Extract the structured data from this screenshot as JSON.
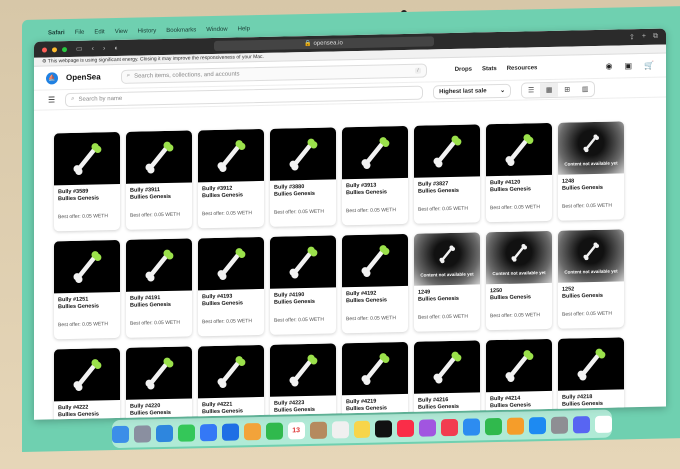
{
  "menubar": {
    "apple": "",
    "app": "Safari",
    "items": [
      "File",
      "Edit",
      "View",
      "History",
      "Bookmarks",
      "Window",
      "Help"
    ]
  },
  "browser": {
    "url": "opensea.io",
    "energy_notice": "This webpage is using significant energy. Closing it may improve the responsiveness of your Mac."
  },
  "nav": {
    "logo": "OpenSea",
    "search_placeholder": "Search items, collections, and accounts",
    "search_shortcut": "/",
    "links": [
      "Drops",
      "Stats",
      "Resources"
    ]
  },
  "filter": {
    "search_placeholder": "Search by name",
    "sort_label": "Highest last sale"
  },
  "items": [
    {
      "name": "Bully #3589",
      "collection": "Bullies Genesis",
      "offer": "Best offer: 0.05 WETH",
      "available": true
    },
    {
      "name": "Bully #3911",
      "collection": "Bullies Genesis",
      "offer": "Best offer: 0.05 WETH",
      "available": true
    },
    {
      "name": "Bully #3912",
      "collection": "Bullies Genesis",
      "offer": "Best offer: 0.05 WETH",
      "available": true
    },
    {
      "name": "Bully #3880",
      "collection": "Bullies Genesis",
      "offer": "Best offer: 0.05 WETH",
      "available": true
    },
    {
      "name": "Bully #3913",
      "collection": "Bullies Genesis",
      "offer": "Best offer: 0.05 WETH",
      "available": true
    },
    {
      "name": "Bully #3827",
      "collection": "Bullies Genesis",
      "offer": "Best offer: 0.05 WETH",
      "available": true
    },
    {
      "name": "Bully #4120",
      "collection": "Bullies Genesis",
      "offer": "Best offer: 0.05 WETH",
      "available": true
    },
    {
      "name": "1248",
      "collection": "Bullies Genesis",
      "offer": "Best offer: 0.05 WETH",
      "available": false
    },
    {
      "name": "Bully #1251",
      "collection": "Bullies Genesis",
      "offer": "Best offer: 0.05 WETH",
      "available": true
    },
    {
      "name": "Bully #4191",
      "collection": "Bullies Genesis",
      "offer": "Best offer: 0.05 WETH",
      "available": true
    },
    {
      "name": "Bully #4193",
      "collection": "Bullies Genesis",
      "offer": "Best offer: 0.05 WETH",
      "available": true
    },
    {
      "name": "Bully #4190",
      "collection": "Bullies Genesis",
      "offer": "Best offer: 0.05 WETH",
      "available": true
    },
    {
      "name": "Bully #4192",
      "collection": "Bullies Genesis",
      "offer": "Best offer: 0.05 WETH",
      "available": true
    },
    {
      "name": "1249",
      "collection": "Bullies Genesis",
      "offer": "Best offer: 0.05 WETH",
      "available": false
    },
    {
      "name": "1250",
      "collection": "Bullies Genesis",
      "offer": "Best offer: 0.05 WETH",
      "available": false
    },
    {
      "name": "1252",
      "collection": "Bullies Genesis",
      "offer": "Best offer: 0.05 WETH",
      "available": false
    },
    {
      "name": "Bully #4222",
      "collection": "Bullies Genesis",
      "offer": "",
      "available": true
    },
    {
      "name": "Bully #4220",
      "collection": "Bullies Genesis",
      "offer": "",
      "available": true
    },
    {
      "name": "Bully #4221",
      "collection": "Bullies Genesis",
      "offer": "",
      "available": true
    },
    {
      "name": "Bully #4223",
      "collection": "Bullies Genesis",
      "offer": "",
      "available": true
    },
    {
      "name": "Bully #4219",
      "collection": "Bullies Genesis",
      "offer": "",
      "available": true
    },
    {
      "name": "Bully #4216",
      "collection": "Bullies Genesis",
      "offer": "",
      "available": true
    },
    {
      "name": "Bully #4214",
      "collection": "Bullies Genesis",
      "offer": "",
      "available": true
    },
    {
      "name": "Bully #4218",
      "collection": "Bullies Genesis",
      "offer": "",
      "available": true
    }
  ],
  "unavailable_text": "Content not available yet",
  "dock": {
    "calendar_day": "13",
    "apps": [
      {
        "name": "finder",
        "color": "#3c8ee8"
      },
      {
        "name": "launchpad",
        "color": "#8a8fa0"
      },
      {
        "name": "safari",
        "color": "#2e86de"
      },
      {
        "name": "messages",
        "color": "#34c759"
      },
      {
        "name": "mail",
        "color": "#3478f6"
      },
      {
        "name": "appstore-a",
        "color": "#1f6fe5"
      },
      {
        "name": "photos",
        "color": "#f2a33a"
      },
      {
        "name": "facetime",
        "color": "#30b94d"
      },
      {
        "name": "calendar",
        "color": "#ffffff"
      },
      {
        "name": "contacts",
        "color": "#b58a5e"
      },
      {
        "name": "reminders",
        "color": "#f0f0f0"
      },
      {
        "name": "notes",
        "color": "#f7d54a"
      },
      {
        "name": "tv",
        "color": "#111111"
      },
      {
        "name": "music",
        "color": "#fa2d48"
      },
      {
        "name": "podcasts",
        "color": "#a155e0"
      },
      {
        "name": "news",
        "color": "#f23c50"
      },
      {
        "name": "keynote",
        "color": "#2d8cf0"
      },
      {
        "name": "numbers",
        "color": "#30b94d"
      },
      {
        "name": "pages",
        "color": "#f59d2a"
      },
      {
        "name": "appstore",
        "color": "#1d8af2"
      },
      {
        "name": "settings",
        "color": "#8e8e93"
      },
      {
        "name": "discord",
        "color": "#5865f2"
      },
      {
        "name": "document",
        "color": "#ffffff"
      }
    ]
  }
}
